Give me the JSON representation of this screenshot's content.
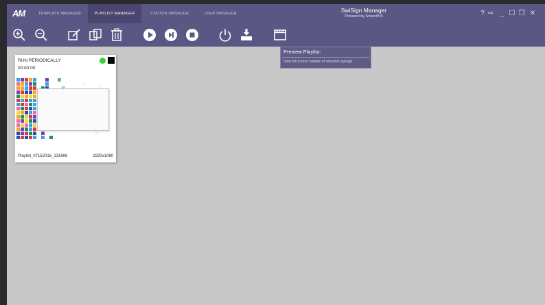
{
  "app": {
    "logo_text": "AM",
    "title": "SwiSign Manager",
    "subtitle": "Powered by SmartAVS"
  },
  "tabs": [
    {
      "label": "Template Manager",
      "active": false
    },
    {
      "label": "Playlist Manager",
      "active": true
    },
    {
      "label": "Station Manager",
      "active": false
    },
    {
      "label": "User Manager",
      "active": false
    }
  ],
  "window_controls": [
    "help-icon",
    "logout-icon",
    "minimize-icon",
    "maximize-icon",
    "restore-icon",
    "close-icon"
  ],
  "window_glyphs": {
    "help": "?",
    "logout": "⇨",
    "minimize": "_",
    "maximize": "☐",
    "restore": "❐",
    "close": "✕"
  },
  "toolbar": {
    "icons": [
      "zoom-in-icon",
      "zoom-out-icon",
      "edit-icon",
      "copy-icon",
      "delete-icon",
      "play-icon",
      "skip-icon",
      "stop-icon",
      "power-icon",
      "download-icon",
      "preview-icon"
    ]
  },
  "tooltip": {
    "title": "Preview Playlist:",
    "description": "View full screen sample of selected signage"
  },
  "playlist_card": {
    "run_mode": "RUN PERIODICALLY",
    "time": "00:00:00",
    "name": "Playlist_07152016_131606",
    "resolution": "1920x1080",
    "status_color": "#3ecf3e",
    "indicator_color": "#000000"
  },
  "colors": {
    "titlebar": "#5b5784",
    "background": "#c8c8c8",
    "thumb_palette": [
      "#e2373f",
      "#f5a623",
      "#2c4bb0",
      "#3aa3dc",
      "#7a3fb3",
      "#1f8e5a",
      "#f4d03f",
      "#e86fa8"
    ]
  }
}
